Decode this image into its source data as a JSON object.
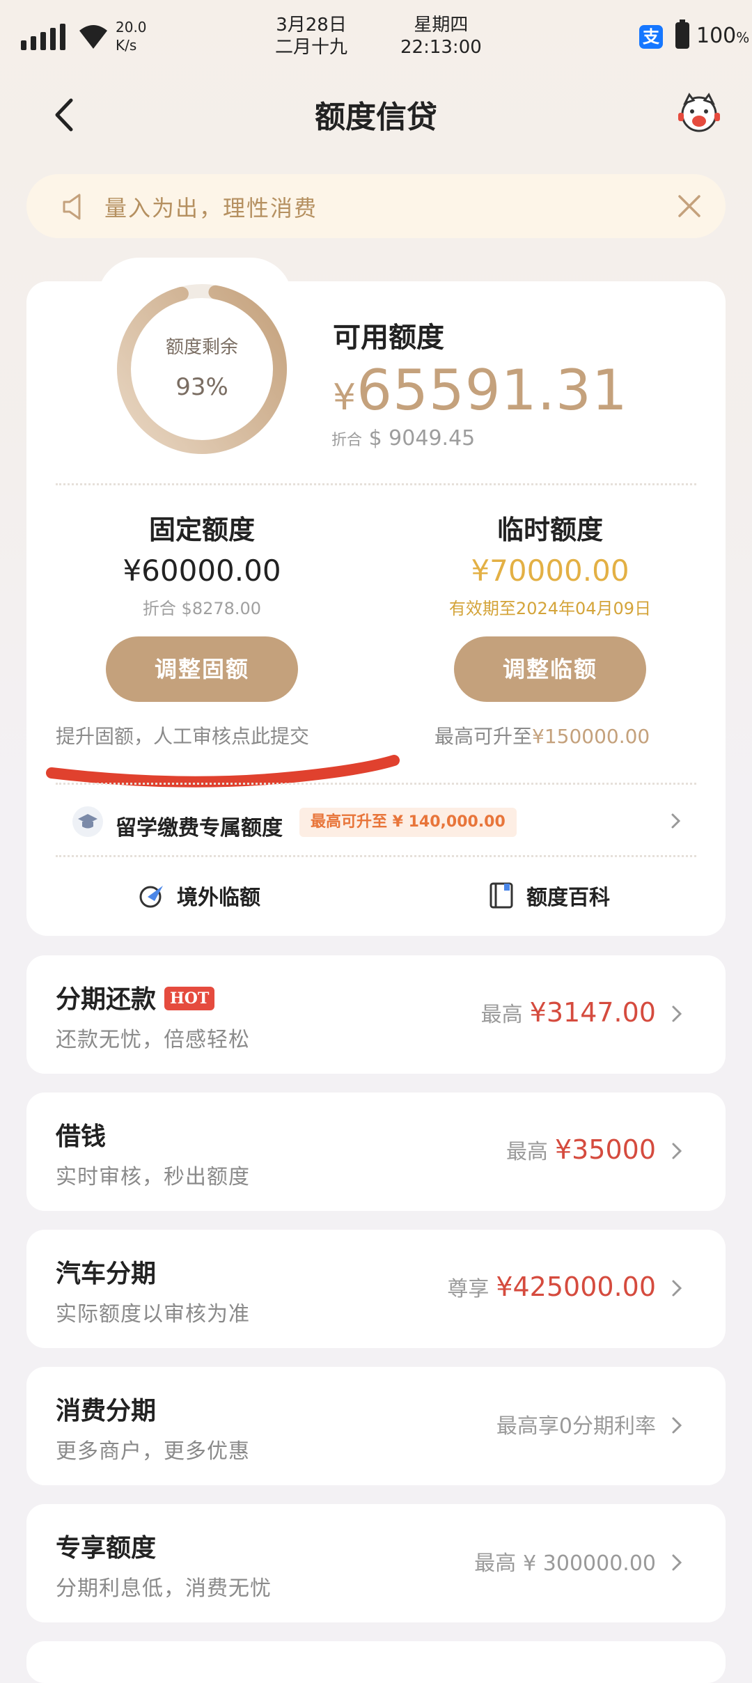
{
  "status_bar": {
    "net_speed_value": "20.0",
    "net_speed_unit": "K/s",
    "date": "3月28日",
    "lunar_date": "二月十九",
    "weekday": "星期四",
    "time": "22:13:00",
    "battery": "100"
  },
  "header": {
    "title": "额度信贷"
  },
  "notice": {
    "text": "量入为出，理性消费"
  },
  "credit": {
    "ring_label": "额度剩余",
    "ring_percent": "93%",
    "ring_fraction": 0.93,
    "available_label": "可用额度",
    "currency_symbol": "¥",
    "available_amount": "65591.31",
    "converted_prefix": "折合",
    "converted_amount": "$ 9049.45",
    "fixed": {
      "title": "固定额度",
      "amount": "¥60000.00",
      "converted": "折合 $8278.00",
      "button": "调整固额",
      "hint": "提升固额，人工审核点此提交"
    },
    "temporary": {
      "title": "临时额度",
      "amount": "¥70000.00",
      "validity": "有效期至2024年04月09日",
      "button": "调整临额",
      "hint_prefix": "最高可升至",
      "hint_value": "¥150000.00"
    },
    "study": {
      "label": "留学缴费专属额度",
      "badge": "最高可升至 ¥ 140,000.00"
    },
    "links": {
      "overseas": "境外临额",
      "encyclopedia": "额度百科"
    }
  },
  "services": [
    {
      "title": "分期还款",
      "badge": "HOT",
      "subtitle": "还款无忧，倍感轻松",
      "right_label": "最高",
      "right_value": "¥3147.00"
    },
    {
      "title": "借钱",
      "subtitle": "实时审核，秒出额度",
      "right_label": "最高",
      "right_value": "¥35000"
    },
    {
      "title": "汽车分期",
      "subtitle": "实际额度以审核为准",
      "right_label": "尊享",
      "right_value": "¥425000.00"
    },
    {
      "title": "消费分期",
      "subtitle": "更多商户，更多优惠",
      "right_label": "最高享0分期利率"
    },
    {
      "title": "专享额度",
      "subtitle": "分期利息低，消费无忧",
      "right_label": "最高",
      "right_value": "¥ 300000.00"
    }
  ],
  "colors": {
    "gold": "#c4a17c",
    "accent_red": "#d54b3e",
    "temp_amount": "#e3b044"
  }
}
